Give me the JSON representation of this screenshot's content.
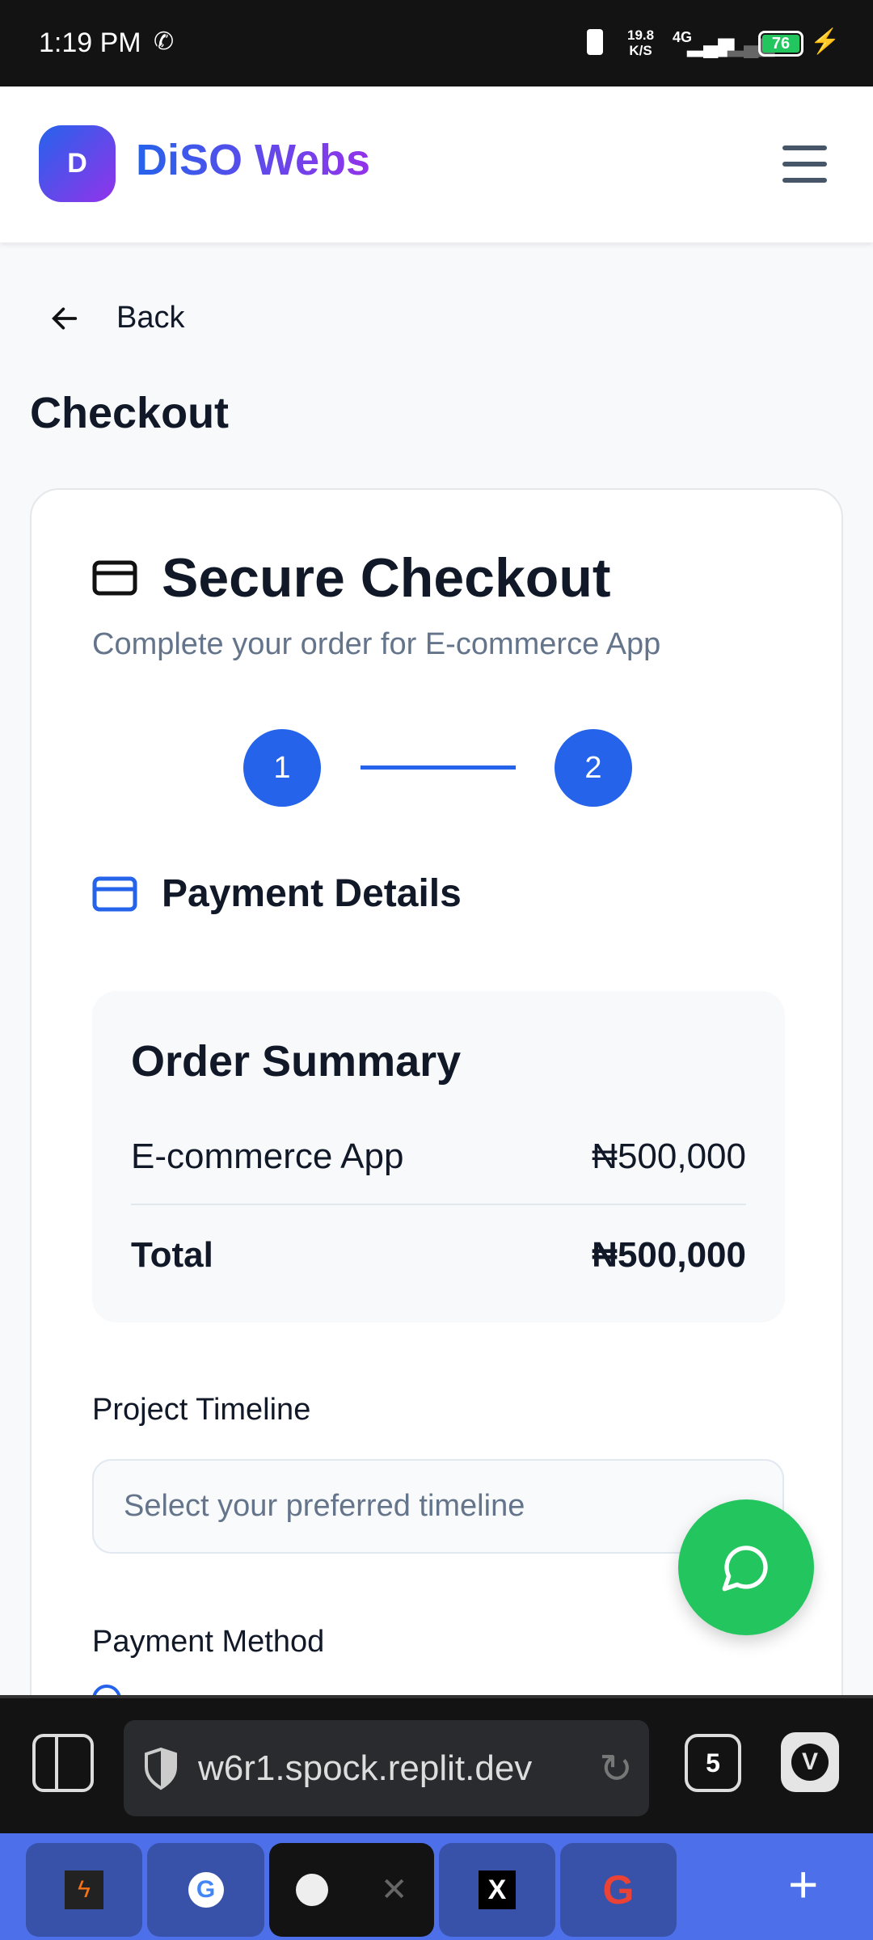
{
  "status_bar": {
    "time": "1:19 PM",
    "net_speed": "19.8",
    "net_unit": "K/S",
    "network": "4G",
    "battery": "76"
  },
  "header": {
    "logo_letter": "D",
    "brand": "DiSO Webs"
  },
  "page": {
    "back": "Back",
    "title": "Checkout"
  },
  "card": {
    "title": "Secure Checkout",
    "subtitle": "Complete your order for E-commerce App",
    "steps": [
      "1",
      "2"
    ],
    "section": "Payment Details",
    "summary": {
      "title": "Order Summary",
      "item": "E-commerce App",
      "item_price": "₦500,000",
      "total_label": "Total",
      "total": "₦500,000"
    },
    "timeline_label": "Project Timeline",
    "timeline_placeholder": "Select your preferred timeline",
    "payment_label": "Payment Method"
  },
  "browser": {
    "url": "w6r1.spock.replit.dev",
    "tab_count": "5"
  },
  "colors": {
    "accent": "#2563eb",
    "fab": "#22c55e"
  }
}
